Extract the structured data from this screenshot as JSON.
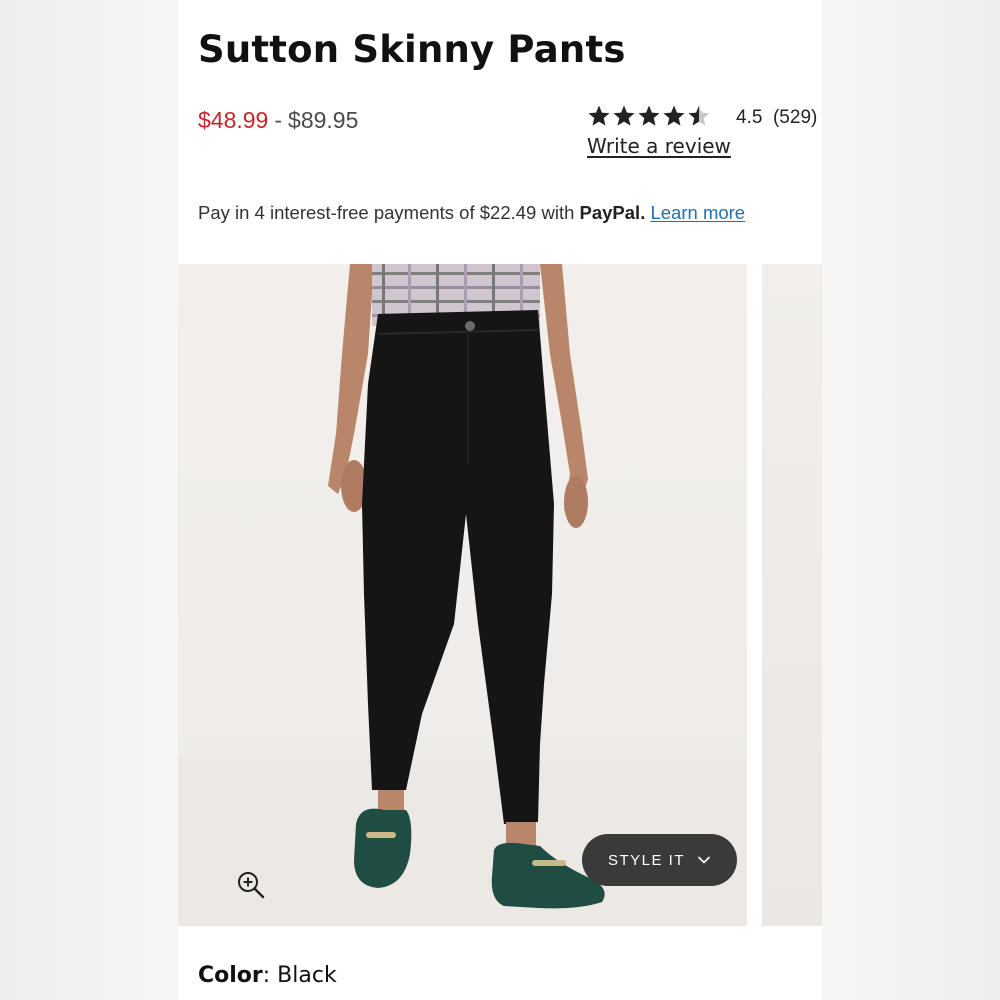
{
  "product": {
    "title": "Sutton Skinny Pants",
    "price_sale": "$48.99",
    "price_separator": "-",
    "price_regular": "$89.95"
  },
  "rating": {
    "stars": 4.5,
    "value": "4.5",
    "count": "(529)",
    "write_review_label": "Write a review"
  },
  "paypal": {
    "text": "Pay in 4 interest-free payments of $22.49 with",
    "brand": "PayPal.",
    "learn_more": "Learn more"
  },
  "gallery": {
    "style_it_label": "STYLE IT",
    "zoom_icon": "zoom-in-icon"
  },
  "color": {
    "label": "Color",
    "value": "Black"
  },
  "colors": {
    "sale_red": "#c8252c",
    "link_blue": "#1f6fb4",
    "pants_black": "#151515",
    "loafer_green": "#1f4d44"
  }
}
